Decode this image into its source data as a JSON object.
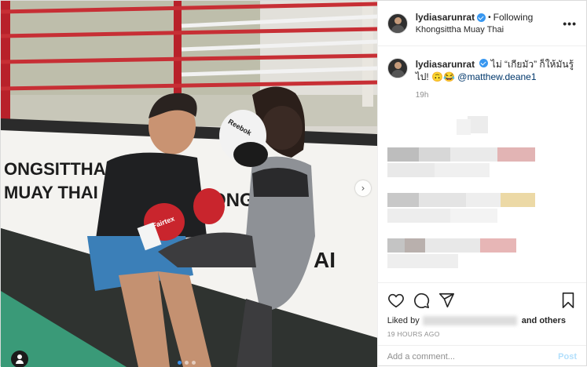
{
  "post": {
    "author": {
      "username": "lydiasarunrat",
      "verified": true,
      "follow_status": "Following",
      "separator": "•",
      "location": "Khongsittha Muay Thai"
    },
    "photo": {
      "banner_text_left_1": "ONGSITTHA",
      "banner_text_left_2": "MUAY THAI",
      "banner_text_right": "AI",
      "banner_text_mid": "ONG",
      "glove_brand_red": "Fairtex",
      "glove_brand_white": "Reebok",
      "carousel_dots": 3,
      "active_dot": 0
    },
    "caption": {
      "username": "lydiasarunrat",
      "text": "ไม่ “เกียมัว” ก็ให้มันรู้ไป! 🙃😂 ",
      "mention": "@matthew.deane1",
      "time": "19h"
    },
    "likes": {
      "prefix": "Liked by",
      "suffix": "and others"
    },
    "timestamp": "19 HOURS AGO",
    "comment_input": {
      "placeholder": "Add a comment...",
      "post_label": "Post"
    },
    "icons": {
      "more": "more-options-icon",
      "like": "heart-icon",
      "comment": "comment-icon",
      "share": "share-icon",
      "save": "bookmark-icon",
      "next": "chevron-right-icon",
      "tag": "user-tag-icon"
    },
    "colors": {
      "link": "#00376b",
      "verified": "#3897f0",
      "post_disabled": "#b2dffc",
      "muted": "#8e8e8e"
    }
  }
}
